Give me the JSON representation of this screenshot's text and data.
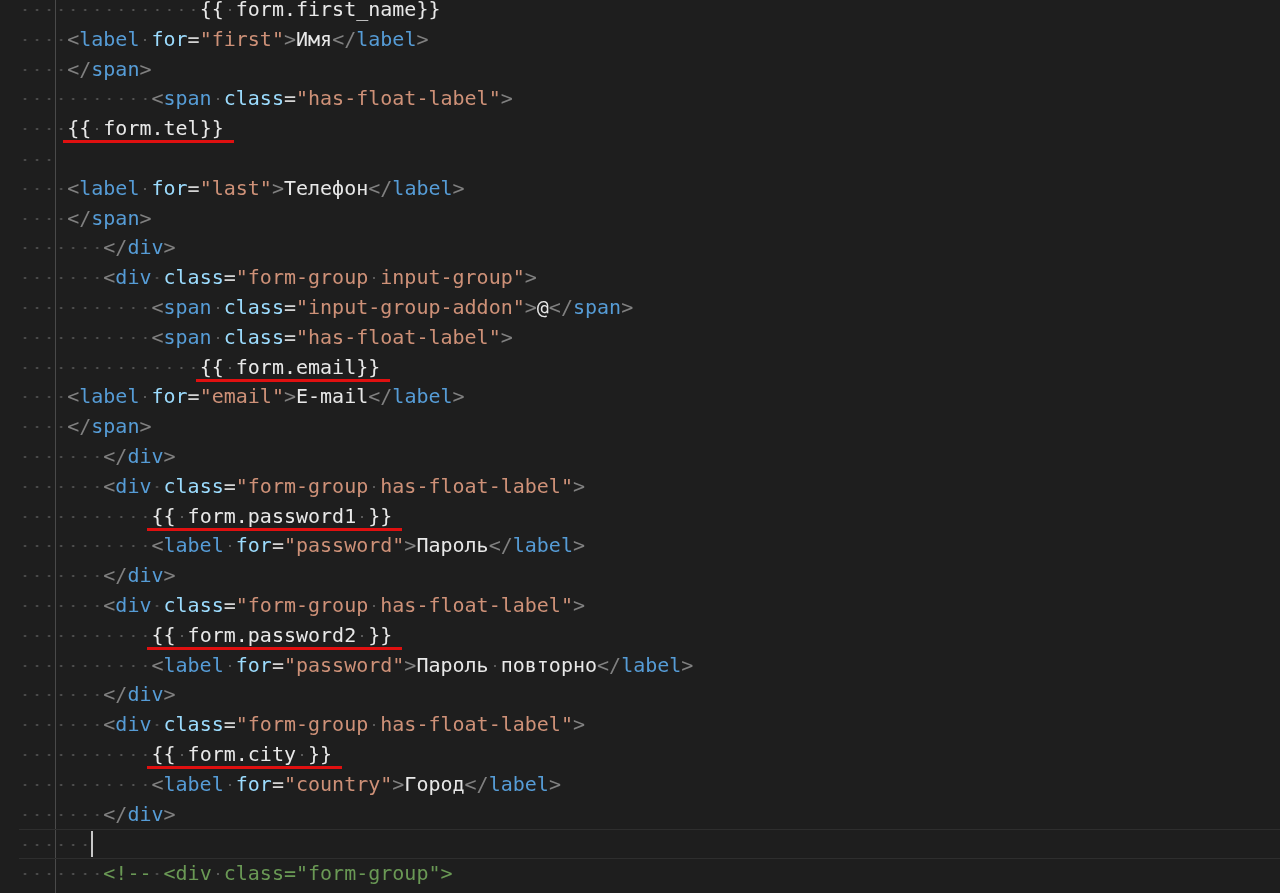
{
  "editor": {
    "lines": [
      {
        "current": false,
        "tokens": [
          {
            "kind": "template",
            "text": "               {{ form.first_name}}",
            "underlined": false
          }
        ]
      },
      {
        "current": false,
        "tokens": [
          {
            "kind": "punct",
            "text": "    <"
          },
          {
            "kind": "tag",
            "text": "label"
          },
          {
            "kind": "attr",
            "text": " for"
          },
          {
            "kind": "op",
            "text": "="
          },
          {
            "kind": "string",
            "text": "\"first\""
          },
          {
            "kind": "punct",
            "text": ">"
          },
          {
            "kind": "text",
            "text": "Имя"
          },
          {
            "kind": "punct",
            "text": "</"
          },
          {
            "kind": "tag",
            "text": "label"
          },
          {
            "kind": "punct",
            "text": ">"
          }
        ]
      },
      {
        "current": false,
        "tokens": [
          {
            "kind": "punct",
            "text": "    </"
          },
          {
            "kind": "tag",
            "text": "span"
          },
          {
            "kind": "punct",
            "text": ">"
          }
        ]
      },
      {
        "current": false,
        "tokens": [
          {
            "kind": "punct",
            "text": "           <"
          },
          {
            "kind": "tag",
            "text": "span"
          },
          {
            "kind": "attr",
            "text": " class"
          },
          {
            "kind": "op",
            "text": "="
          },
          {
            "kind": "string",
            "text": "\"has-float-label\""
          },
          {
            "kind": "punct",
            "text": ">"
          }
        ]
      },
      {
        "current": false,
        "tokens": [
          {
            "kind": "template",
            "text": "    {{ form.tel}}",
            "underlined": true
          }
        ]
      },
      {
        "current": false
      },
      {
        "current": false,
        "tokens": [
          {
            "kind": "punct",
            "text": "    <"
          },
          {
            "kind": "tag",
            "text": "label"
          },
          {
            "kind": "attr",
            "text": " for"
          },
          {
            "kind": "op",
            "text": "="
          },
          {
            "kind": "string",
            "text": "\"last\""
          },
          {
            "kind": "punct",
            "text": ">"
          },
          {
            "kind": "text",
            "text": "Телефон"
          },
          {
            "kind": "punct",
            "text": "</"
          },
          {
            "kind": "tag",
            "text": "label"
          },
          {
            "kind": "punct",
            "text": ">"
          }
        ]
      },
      {
        "current": false,
        "tokens": [
          {
            "kind": "punct",
            "text": "    </"
          },
          {
            "kind": "tag",
            "text": "span"
          },
          {
            "kind": "punct",
            "text": ">"
          }
        ]
      },
      {
        "current": false,
        "tokens": [
          {
            "kind": "punct",
            "text": "       </"
          },
          {
            "kind": "tag",
            "text": "div"
          },
          {
            "kind": "punct",
            "text": ">"
          }
        ]
      },
      {
        "current": false,
        "tokens": [
          {
            "kind": "punct",
            "text": "       <"
          },
          {
            "kind": "tag",
            "text": "div"
          },
          {
            "kind": "attr",
            "text": " class"
          },
          {
            "kind": "op",
            "text": "="
          },
          {
            "kind": "string",
            "text": "\"form-group input-group\""
          },
          {
            "kind": "punct",
            "text": ">"
          }
        ]
      },
      {
        "current": false,
        "tokens": [
          {
            "kind": "punct",
            "text": "           <"
          },
          {
            "kind": "tag",
            "text": "span"
          },
          {
            "kind": "attr",
            "text": " class"
          },
          {
            "kind": "op",
            "text": "="
          },
          {
            "kind": "string",
            "text": "\"input-group-addon\""
          },
          {
            "kind": "punct",
            "text": ">"
          },
          {
            "kind": "text",
            "text": "@"
          },
          {
            "kind": "punct",
            "text": "</"
          },
          {
            "kind": "tag",
            "text": "span"
          },
          {
            "kind": "punct",
            "text": ">"
          }
        ]
      },
      {
        "current": false,
        "tokens": [
          {
            "kind": "punct",
            "text": "           <"
          },
          {
            "kind": "tag",
            "text": "span"
          },
          {
            "kind": "attr",
            "text": " class"
          },
          {
            "kind": "op",
            "text": "="
          },
          {
            "kind": "string",
            "text": "\"has-float-label\""
          },
          {
            "kind": "punct",
            "text": ">"
          }
        ]
      },
      {
        "current": false,
        "tokens": [
          {
            "kind": "template",
            "text": "               {{ form.email}}",
            "underlined": true
          }
        ]
      },
      {
        "current": false,
        "tokens": [
          {
            "kind": "punct",
            "text": "    <"
          },
          {
            "kind": "tag",
            "text": "label"
          },
          {
            "kind": "attr",
            "text": " for"
          },
          {
            "kind": "op",
            "text": "="
          },
          {
            "kind": "string",
            "text": "\"email\""
          },
          {
            "kind": "punct",
            "text": ">"
          },
          {
            "kind": "text",
            "text": "E-mail"
          },
          {
            "kind": "punct",
            "text": "</"
          },
          {
            "kind": "tag",
            "text": "label"
          },
          {
            "kind": "punct",
            "text": ">"
          }
        ]
      },
      {
        "current": false,
        "tokens": [
          {
            "kind": "punct",
            "text": "    </"
          },
          {
            "kind": "tag",
            "text": "span"
          },
          {
            "kind": "punct",
            "text": ">"
          }
        ]
      },
      {
        "current": false,
        "tokens": [
          {
            "kind": "punct",
            "text": "       </"
          },
          {
            "kind": "tag",
            "text": "div"
          },
          {
            "kind": "punct",
            "text": ">"
          }
        ]
      },
      {
        "current": false,
        "tokens": [
          {
            "kind": "punct",
            "text": "       <"
          },
          {
            "kind": "tag",
            "text": "div"
          },
          {
            "kind": "attr",
            "text": " class"
          },
          {
            "kind": "op",
            "text": "="
          },
          {
            "kind": "string",
            "text": "\"form-group has-float-label\""
          },
          {
            "kind": "punct",
            "text": ">"
          }
        ]
      },
      {
        "current": false,
        "tokens": [
          {
            "kind": "template",
            "text": "           {{ form.password1 }}",
            "underlined": true
          }
        ]
      },
      {
        "current": false,
        "tokens": [
          {
            "kind": "punct",
            "text": "           <"
          },
          {
            "kind": "tag",
            "text": "label"
          },
          {
            "kind": "attr",
            "text": " for"
          },
          {
            "kind": "op",
            "text": "="
          },
          {
            "kind": "string",
            "text": "\"password\""
          },
          {
            "kind": "punct",
            "text": ">"
          },
          {
            "kind": "text",
            "text": "Пароль"
          },
          {
            "kind": "punct",
            "text": "</"
          },
          {
            "kind": "tag",
            "text": "label"
          },
          {
            "kind": "punct",
            "text": ">"
          }
        ]
      },
      {
        "current": false,
        "tokens": [
          {
            "kind": "punct",
            "text": "       </"
          },
          {
            "kind": "tag",
            "text": "div"
          },
          {
            "kind": "punct",
            "text": ">"
          }
        ]
      },
      {
        "current": false,
        "tokens": [
          {
            "kind": "punct",
            "text": "       <"
          },
          {
            "kind": "tag",
            "text": "div"
          },
          {
            "kind": "attr",
            "text": " class"
          },
          {
            "kind": "op",
            "text": "="
          },
          {
            "kind": "string",
            "text": "\"form-group has-float-label\""
          },
          {
            "kind": "punct",
            "text": ">"
          }
        ]
      },
      {
        "current": false,
        "tokens": [
          {
            "kind": "template",
            "text": "           {{ form.password2 }}",
            "underlined": true
          }
        ]
      },
      {
        "current": false,
        "tokens": [
          {
            "kind": "punct",
            "text": "           <"
          },
          {
            "kind": "tag",
            "text": "label"
          },
          {
            "kind": "attr",
            "text": " for"
          },
          {
            "kind": "op",
            "text": "="
          },
          {
            "kind": "string",
            "text": "\"password\""
          },
          {
            "kind": "punct",
            "text": ">"
          },
          {
            "kind": "text",
            "text": "Пароль повторно"
          },
          {
            "kind": "punct",
            "text": "</"
          },
          {
            "kind": "tag",
            "text": "label"
          },
          {
            "kind": "punct",
            "text": ">"
          }
        ]
      },
      {
        "current": false,
        "tokens": [
          {
            "kind": "punct",
            "text": "       </"
          },
          {
            "kind": "tag",
            "text": "div"
          },
          {
            "kind": "punct",
            "text": ">"
          }
        ]
      },
      {
        "current": false,
        "tokens": [
          {
            "kind": "punct",
            "text": "       <"
          },
          {
            "kind": "tag",
            "text": "div"
          },
          {
            "kind": "attr",
            "text": " class"
          },
          {
            "kind": "op",
            "text": "="
          },
          {
            "kind": "string",
            "text": "\"form-group has-float-label\""
          },
          {
            "kind": "punct",
            "text": ">"
          }
        ]
      },
      {
        "current": false,
        "tokens": [
          {
            "kind": "template",
            "text": "           {{ form.city }}",
            "underlined": true
          }
        ]
      },
      {
        "current": false,
        "tokens": [
          {
            "kind": "punct",
            "text": "           <"
          },
          {
            "kind": "tag",
            "text": "label"
          },
          {
            "kind": "attr",
            "text": " for"
          },
          {
            "kind": "op",
            "text": "="
          },
          {
            "kind": "string",
            "text": "\"country\""
          },
          {
            "kind": "punct",
            "text": ">"
          },
          {
            "kind": "text",
            "text": "Город"
          },
          {
            "kind": "punct",
            "text": "</"
          },
          {
            "kind": "tag",
            "text": "label"
          },
          {
            "kind": "punct",
            "text": ">"
          }
        ]
      },
      {
        "current": false,
        "tokens": [
          {
            "kind": "punct",
            "text": "       </"
          },
          {
            "kind": "tag",
            "text": "div"
          },
          {
            "kind": "punct",
            "text": ">"
          }
        ]
      },
      {
        "current": true
      },
      {
        "current": false,
        "tokens": [
          {
            "kind": "comment",
            "text": "       <!-- <div class=\"form-group\">"
          }
        ]
      }
    ]
  }
}
